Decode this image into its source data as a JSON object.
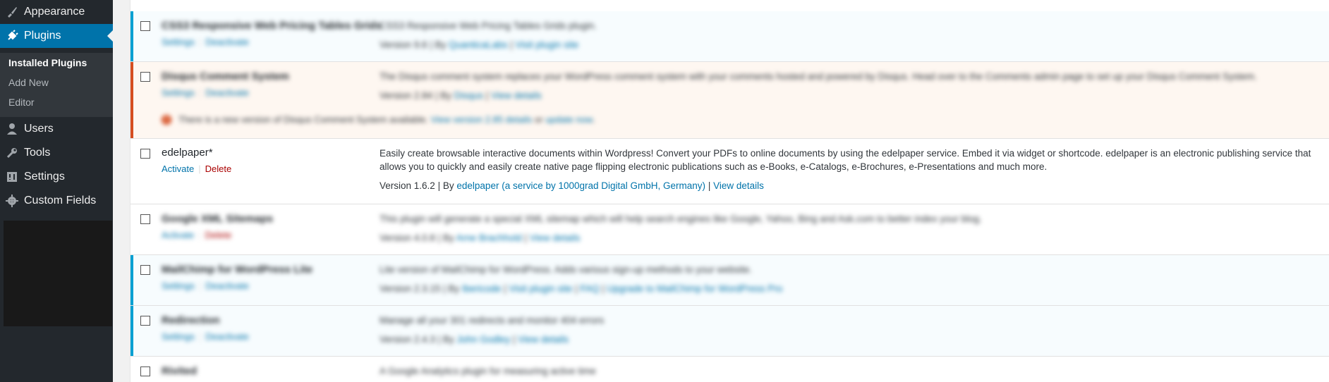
{
  "sidebar": {
    "items": [
      {
        "label": "Appearance",
        "icon": "paintbrush-icon"
      },
      {
        "label": "Plugins",
        "icon": "plugin-icon"
      },
      {
        "label": "Users",
        "icon": "users-icon"
      },
      {
        "label": "Tools",
        "icon": "wrench-icon"
      },
      {
        "label": "Settings",
        "icon": "settings-icon"
      },
      {
        "label": "Custom Fields",
        "icon": "gear-icon"
      }
    ],
    "submenu": [
      "Installed Plugins",
      "Add New",
      "Editor"
    ]
  },
  "plugins": [
    {
      "name": "CSS3 Responsive Web Pricing Tables Grids",
      "actions": [
        "Settings",
        "Deactivate"
      ],
      "description": "CSS3 Responsive Web Pricing Tables Grids plugin.",
      "version": "Version 9.6",
      "author": "QuanticaLabs",
      "link": "Visit plugin site"
    },
    {
      "name": "Disqus Comment System",
      "actions": [
        "Settings",
        "Deactivate"
      ],
      "description": "The Disqus comment system replaces your WordPress comment system with your comments hosted and powered by Disqus. Head over to the Comments admin page to set up your Disqus Comment System.",
      "version": "Version 2.84",
      "author": "Disqus",
      "link": "View details",
      "notice": {
        "text": "There is a new version of Disqus Comment System available.",
        "link1": "View version 2.85 details",
        "or": "or",
        "link2": "update now",
        "period": "."
      }
    },
    {
      "name": "edelpaper*",
      "actions": [
        "Activate",
        "Delete"
      ],
      "description": "Easily create browsable interactive documents within Wordpress! Convert your PDFs to online documents by using the edelpaper service. Embed it via widget or shortcode. edelpaper is an electronic publishing service that allows you to quickly and easily create native page flipping electronic publications such as e-Books, e-Catalogs, e-Brochures, e-Presentations and much more.",
      "version": "Version 1.6.2",
      "author": "edelpaper (a service by 1000grad Digital GmbH, Germany)",
      "link": "View details"
    },
    {
      "name": "Google XML Sitemaps",
      "actions": [
        "Activate",
        "Delete"
      ],
      "description": "This plugin will generate a special XML sitemap which will help search engines like Google, Yahoo, Bing and Ask.com to better index your blog.",
      "version": "Version 4.0.8",
      "author": "Arne Brachhold",
      "link": "View details"
    },
    {
      "name": "MailChimp for WordPress Lite",
      "actions": [
        "Settings",
        "Deactivate"
      ],
      "description": "Lite version of MailChimp for WordPress. Adds various sign-up methods to your website.",
      "version": "Version 2.3.15",
      "author": "Ibericode",
      "link": "Visit plugin site",
      "extra_links": [
        "FAQ",
        "Upgrade to MailChimp for WordPress Pro"
      ]
    },
    {
      "name": "Redirection",
      "actions": [
        "Settings",
        "Deactivate"
      ],
      "description": "Manage all your 301 redirects and monitor 404 errors",
      "version": "Version 2.4.3",
      "author": "John Godley",
      "link": "View details"
    },
    {
      "name": "Rivited",
      "description": "A Google Analytics plugin for measuring active time"
    }
  ],
  "common": {
    "separator": "|",
    "by": "By"
  }
}
